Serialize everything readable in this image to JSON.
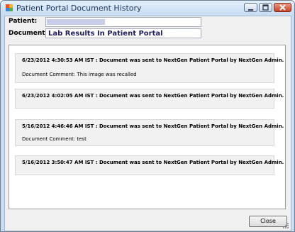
{
  "window": {
    "title": "Patient Portal Document History",
    "controls": [
      "minimize-icon",
      "maximize-icon",
      "close-icon"
    ]
  },
  "form": {
    "patient_label": "Patient:",
    "patient_value": "",
    "document_label": "Document:",
    "document_value": "Lab Results In Patient Portal"
  },
  "history": [
    {
      "title": "6/23/2012 4:30:53 AM IST : Document was sent to NextGen Patient Portal by NextGen Admin.",
      "comment": "Document Comment: This image was recalled"
    },
    {
      "title": "6/23/2012 4:02:05 AM IST : Document was sent to NextGen Patient Portal by NextGen Admin.",
      "comment": ""
    },
    {
      "title": "5/16/2012 4:46:46 AM IST : Document was sent to NextGen Patient Portal by NextGen Admin.",
      "comment": "Document Comment: test"
    },
    {
      "title": "5/16/2012 3:50:47 AM IST : Document was sent to NextGen Patient Portal by NextGen Admin.",
      "comment": ""
    }
  ],
  "buttons": {
    "close_label": "Close"
  }
}
